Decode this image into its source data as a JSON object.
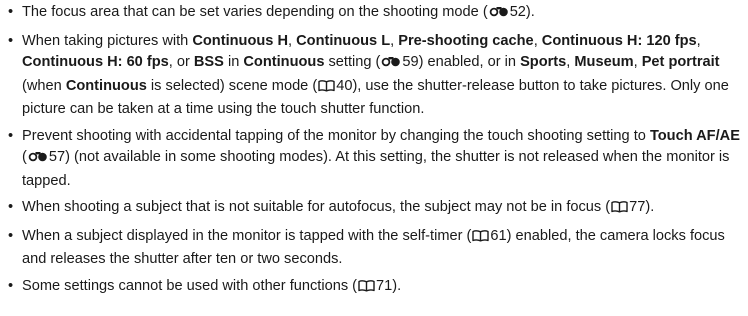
{
  "bullets": [
    {
      "parts": [
        {
          "t": "The focus area that can be set varies depending on the shooting mode ("
        },
        {
          "icon": "menu-reference-icon"
        },
        {
          "t": "52)."
        }
      ]
    },
    {
      "parts": [
        {
          "t": "When taking pictures with "
        },
        {
          "b": "Continuous H"
        },
        {
          "t": ", "
        },
        {
          "b": "Continuous L"
        },
        {
          "t": ", "
        },
        {
          "b": "Pre-shooting cache"
        },
        {
          "t": ", "
        },
        {
          "b": "Continuous H: 120 fps"
        },
        {
          "t": ", "
        },
        {
          "b": "Continuous H: 60 fps"
        },
        {
          "t": ", or "
        },
        {
          "b": "BSS"
        },
        {
          "t": " in "
        },
        {
          "b": "Continuous"
        },
        {
          "t": " setting ("
        },
        {
          "icon": "menu-reference-icon"
        },
        {
          "t": "59) enabled, or in "
        },
        {
          "b": "Sports"
        },
        {
          "t": ", "
        },
        {
          "b": "Museum"
        },
        {
          "t": ", "
        },
        {
          "b": "Pet portrait"
        },
        {
          "t": " (when "
        },
        {
          "b": "Continuous"
        },
        {
          "t": " is selected) scene mode ("
        },
        {
          "icon": "book-reference-icon"
        },
        {
          "t": "40), use the shutter-release button to take pictures. Only one picture can be taken at a time using the touch shutter function."
        }
      ]
    },
    {
      "parts": [
        {
          "t": "Prevent shooting with accidental tapping of the monitor by changing the touch shooting setting to "
        },
        {
          "b": "Touch AF/AE"
        },
        {
          "t": " ("
        },
        {
          "icon": "menu-reference-icon"
        },
        {
          "t": "57) (not available in some shooting modes). At this setting, the shutter is not released when the monitor is tapped."
        }
      ]
    },
    {
      "parts": [
        {
          "t": "When shooting a subject that is not suitable for autofocus, the subject may not be in focus ("
        },
        {
          "icon": "book-reference-icon"
        },
        {
          "t": "77)."
        }
      ]
    },
    {
      "parts": [
        {
          "t": "When a subject displayed in the monitor is tapped with the self-timer ("
        },
        {
          "icon": "book-reference-icon"
        },
        {
          "t": "61) enabled, the camera locks focus and releases the shutter after ten or two seconds."
        }
      ]
    },
    {
      "parts": [
        {
          "t": "Some settings cannot be used with other functions ("
        },
        {
          "icon": "book-reference-icon"
        },
        {
          "t": "71)."
        }
      ]
    }
  ],
  "bullet_char": "•",
  "colors": {
    "text": "#1a1a1a"
  }
}
